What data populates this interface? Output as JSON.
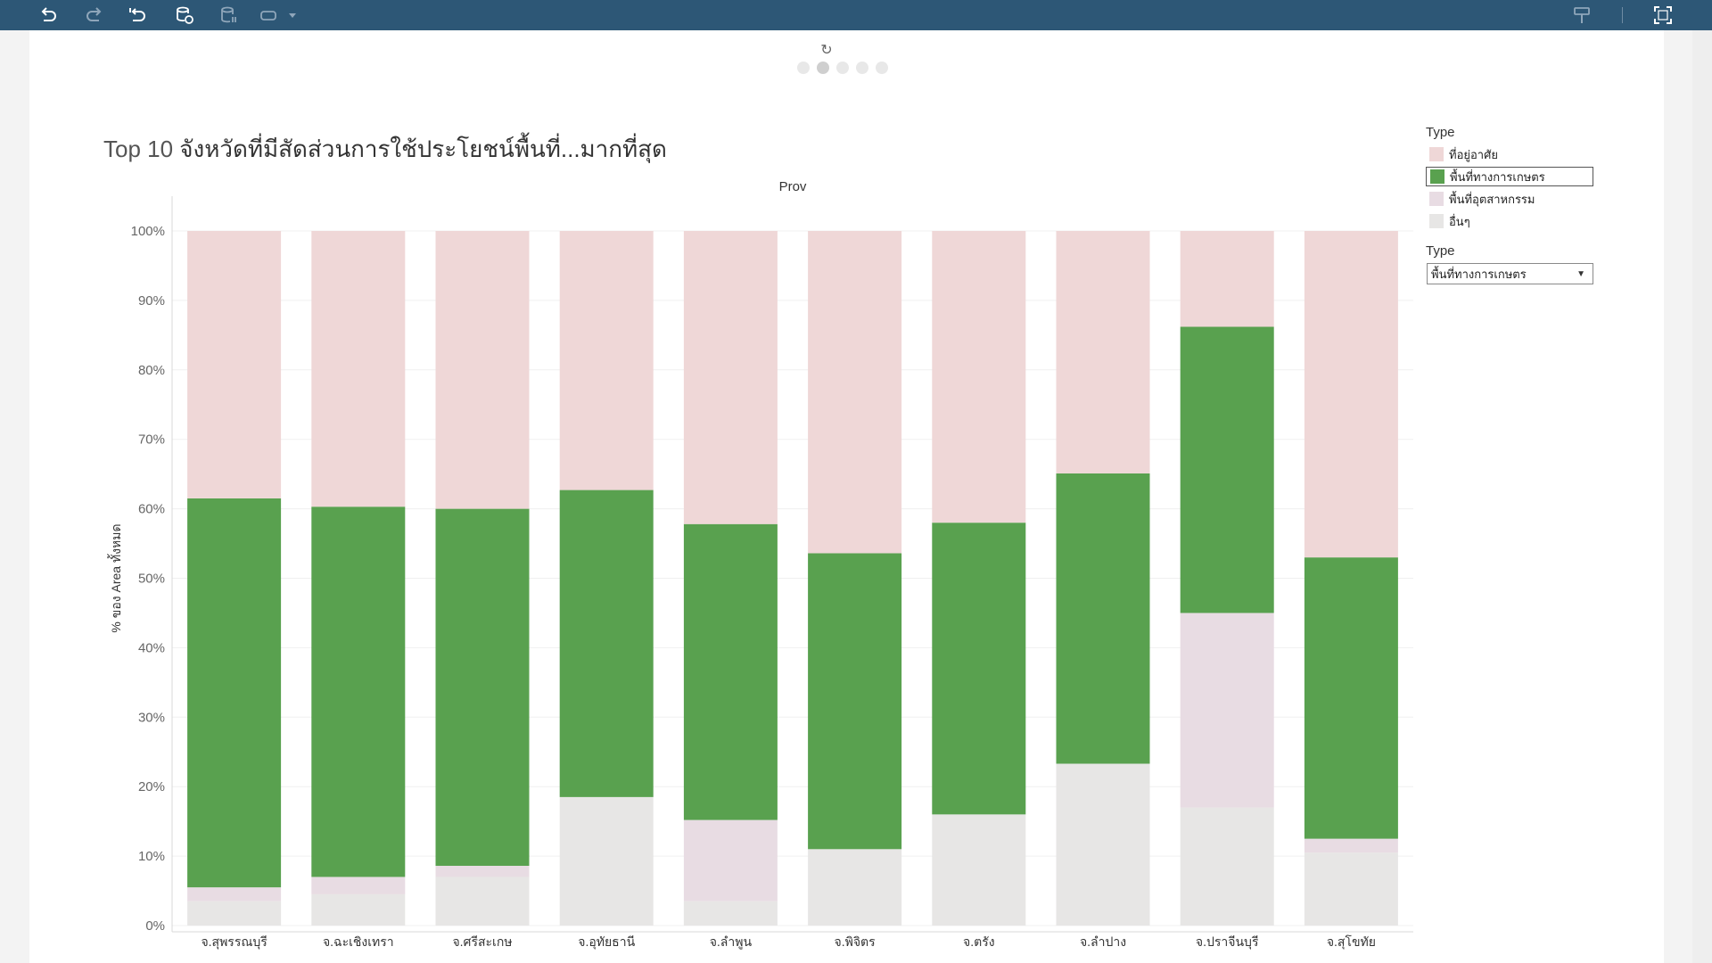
{
  "toolbar": {
    "icons": [
      "undo-icon",
      "redo-icon",
      "revert-icon",
      "refresh-data-icon",
      "pause-updates-icon",
      "view-switch-icon",
      "dropdown-caret-icon",
      "highlight-icon",
      "fullscreen-icon"
    ]
  },
  "navigation": {
    "refresh_glyph": "↻",
    "dots": [
      false,
      true,
      false,
      false,
      false
    ]
  },
  "chart": {
    "title_prefix": "Top 10 ",
    "title_main": "จังหวัดที่มีสัดส่วนการใช้ประโยชน์พื้นที่...มากที่สุด"
  },
  "legend": {
    "title": "Type",
    "items": [
      {
        "label": "ที่อยู่อาศัย",
        "color": "#efd7d7",
        "selected": false
      },
      {
        "label": "พื้นที่ทางการเกษตร",
        "color": "#59a14f",
        "selected": true
      },
      {
        "label": "พื้นที่อุตสาหกรรม",
        "color": "#e8dce3",
        "selected": false
      },
      {
        "label": "อื่นๆ",
        "color": "#e7e6e5",
        "selected": false
      }
    ]
  },
  "filter": {
    "title": "Type",
    "selected": "พื้นที่ทางการเกษตร"
  },
  "chart_data": {
    "type": "bar",
    "stacked": true,
    "top_label": "Prov",
    "ylabel": "% ของ Area ทั้งหมด",
    "ylim": [
      0,
      100
    ],
    "yticks": [
      "0%",
      "10%",
      "20%",
      "30%",
      "40%",
      "50%",
      "60%",
      "70%",
      "80%",
      "90%",
      "100%"
    ],
    "grid": true,
    "categories": [
      "จ.สุพรรณบุรี",
      "จ.ฉะเชิงเทรา",
      "จ.ศรีสะเกษ",
      "จ.อุทัยธานี",
      "จ.ลำพูน",
      "จ.พิจิตร",
      "จ.ตรัง",
      "จ.ลำปาง",
      "จ.ปราจีนบุรี",
      "จ.สุโขทัย"
    ],
    "series": [
      {
        "name": "อื่นๆ",
        "color": "#e7e6e5",
        "values": [
          3.5,
          4.5,
          7.0,
          18.5,
          3.5,
          11.0,
          16.0,
          23.3,
          17.0,
          10.5
        ]
      },
      {
        "name": "พื้นที่อุตสาหกรรม",
        "color": "#e8dce3",
        "values": [
          2.0,
          2.5,
          1.6,
          0,
          11.7,
          0,
          0,
          0,
          28.0,
          2.0
        ]
      },
      {
        "name": "พื้นที่ทางการเกษตร",
        "color": "#59a14f",
        "values": [
          56.0,
          53.3,
          51.4,
          44.2,
          42.6,
          42.6,
          42.0,
          41.8,
          41.2,
          40.5
        ]
      },
      {
        "name": "ที่อยู่อาศัย",
        "color": "#efd7d7",
        "values": [
          38.5,
          39.7,
          40.0,
          37.3,
          42.2,
          46.4,
          42.0,
          34.9,
          13.8,
          47.0
        ]
      }
    ]
  }
}
